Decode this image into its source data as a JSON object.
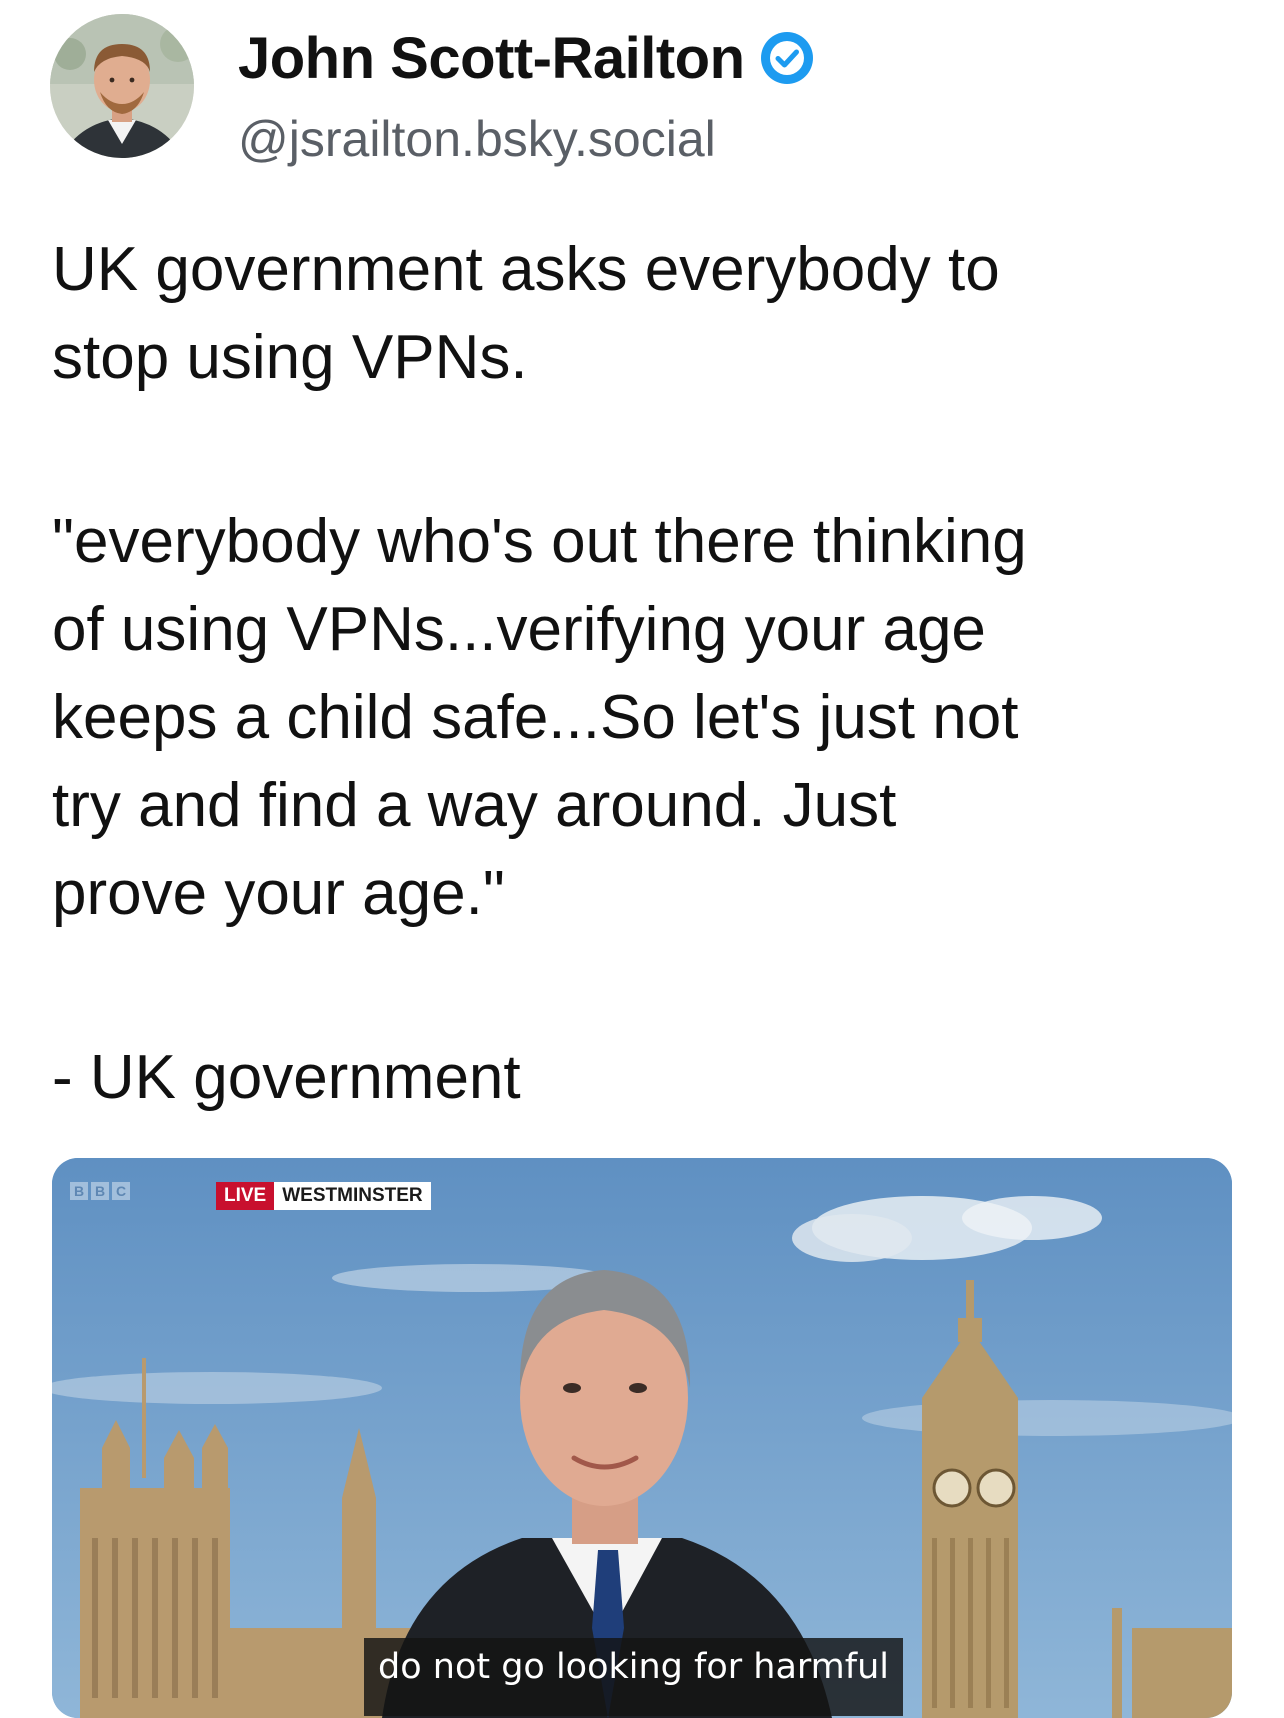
{
  "author": {
    "display_name": "John Scott-Railton",
    "handle": "@jsrailton.bsky.social",
    "verified": true,
    "verified_icon": "verified-check-icon",
    "avatar_icon": "profile-photo"
  },
  "post": {
    "paragraphs": [
      "UK government asks everybody to\nstop using VPNs.",
      "\"everybody who's out there thinking\nof using VPNs...verifying your age\nkeeps a child safe...So let's just not\ntry and find a way around. Just\nprove your age.\"",
      "- UK government"
    ]
  },
  "video": {
    "channel_logo": [
      "B",
      "B",
      "C"
    ],
    "live_label": "LIVE",
    "location_label": "WESTMINSTER",
    "subtitle": "do not go looking for harmful"
  },
  "colors": {
    "verified": "#1d9bf0",
    "handle": "#5a5f66",
    "live_red": "#c8102e",
    "sky": "#6f9ec9"
  }
}
